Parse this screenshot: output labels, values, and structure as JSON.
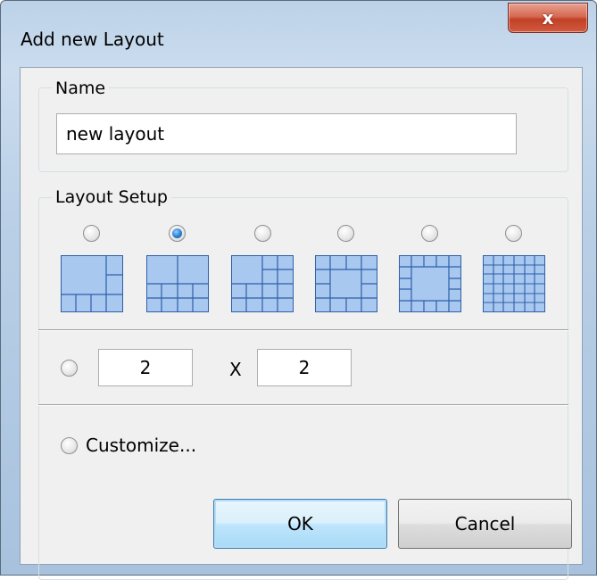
{
  "window": {
    "title": "Add new Layout",
    "close_glyph": "x"
  },
  "name_group": {
    "legend": "Name",
    "value": "new layout"
  },
  "layout_setup": {
    "legend": "Layout Setup",
    "presets": [
      {
        "icon": "layout-1-plus-5-icon",
        "checked": false
      },
      {
        "icon": "layout-1-plus-7-icon",
        "checked": true
      },
      {
        "icon": "layout-1-plus-9-icon",
        "checked": false
      },
      {
        "icon": "layout-1-plus-12-icon",
        "checked": false
      },
      {
        "icon": "layout-1-plus-16-icon",
        "checked": false
      },
      {
        "icon": "layout-4-plus-32-icon",
        "checked": false
      }
    ],
    "grid": {
      "checked": false,
      "rows": "2",
      "separator": "X",
      "cols": "2"
    },
    "customize": {
      "checked": false,
      "label": "Customize..."
    }
  },
  "buttons": {
    "ok_label": "OK",
    "cancel_label": "Cancel"
  },
  "colors": {
    "icon_fill": "#a8c8f0",
    "icon_line": "#2f5fa8",
    "radio_selected": "#2a7fd0"
  }
}
